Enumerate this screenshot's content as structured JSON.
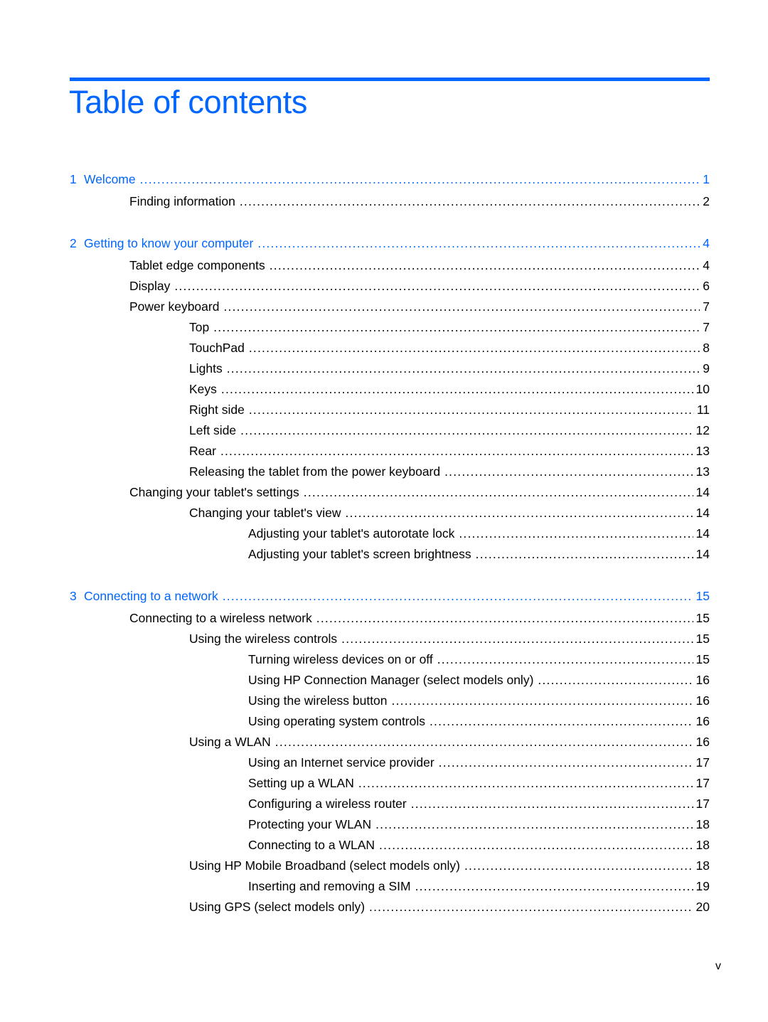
{
  "title": "Table of contents",
  "accent_color": "#0066ff",
  "entries": [
    {
      "level": 0,
      "num": "1",
      "label": "Welcome",
      "page": "1"
    },
    {
      "level": 1,
      "label": "Finding information",
      "page": "2"
    },
    {
      "level": 0,
      "num": "2",
      "label": "Getting to know your computer",
      "page": "4"
    },
    {
      "level": 1,
      "label": "Tablet edge components",
      "page": "4"
    },
    {
      "level": 1,
      "label": "Display",
      "page": "6"
    },
    {
      "level": 1,
      "label": "Power keyboard",
      "page": "7"
    },
    {
      "level": 2,
      "label": "Top",
      "page": "7"
    },
    {
      "level": 2,
      "label": "TouchPad",
      "page": "8"
    },
    {
      "level": 2,
      "label": "Lights",
      "page": "9"
    },
    {
      "level": 2,
      "label": "Keys",
      "page": "10"
    },
    {
      "level": 2,
      "label": "Right side",
      "page": "11"
    },
    {
      "level": 2,
      "label": "Left side",
      "page": "12"
    },
    {
      "level": 2,
      "label": "Rear",
      "page": "13"
    },
    {
      "level": 2,
      "label": "Releasing the tablet from the power keyboard",
      "page": "13"
    },
    {
      "level": 1,
      "label": "Changing your tablet's settings",
      "page": "14"
    },
    {
      "level": 2,
      "label": "Changing your tablet's view",
      "page": "14"
    },
    {
      "level": 3,
      "label": "Adjusting your tablet's autorotate lock",
      "page": "14"
    },
    {
      "level": 3,
      "label": "Adjusting your tablet's screen brightness",
      "page": "14"
    },
    {
      "level": 0,
      "num": "3",
      "label": "Connecting to a network",
      "page": "15"
    },
    {
      "level": 1,
      "label": "Connecting to a wireless network",
      "page": "15"
    },
    {
      "level": 2,
      "label": "Using the wireless controls",
      "page": "15"
    },
    {
      "level": 3,
      "label": "Turning wireless devices on or off",
      "page": "15"
    },
    {
      "level": 3,
      "label": "Using HP Connection Manager (select models only)",
      "page": "16"
    },
    {
      "level": 3,
      "label": "Using the wireless button",
      "page": "16"
    },
    {
      "level": 3,
      "label": "Using operating system controls",
      "page": "16"
    },
    {
      "level": 2,
      "label": "Using a WLAN",
      "page": "16"
    },
    {
      "level": 3,
      "label": "Using an Internet service provider",
      "page": "17"
    },
    {
      "level": 3,
      "label": "Setting up a WLAN",
      "page": "17"
    },
    {
      "level": 3,
      "label": "Configuring a wireless router",
      "page": "17"
    },
    {
      "level": 3,
      "label": "Protecting your WLAN",
      "page": "18"
    },
    {
      "level": 3,
      "label": "Connecting to a WLAN",
      "page": "18"
    },
    {
      "level": 2,
      "label": "Using HP Mobile Broadband (select models only)",
      "page": "18"
    },
    {
      "level": 3,
      "label": "Inserting and removing a SIM",
      "page": "19"
    },
    {
      "level": 2,
      "label": "Using GPS (select models only)",
      "page": "20"
    }
  ],
  "page_number": "v"
}
